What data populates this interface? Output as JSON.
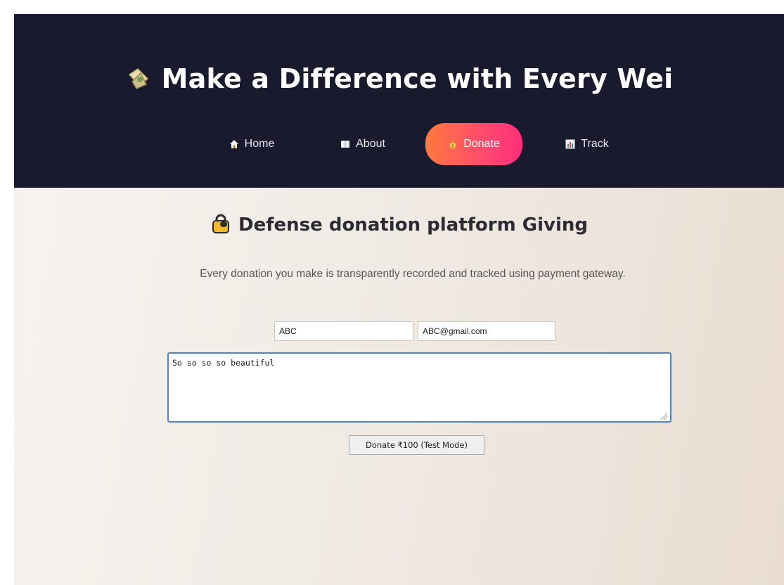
{
  "header": {
    "title": "Make a Difference with Every Wei",
    "title_icon": "money-wings-icon"
  },
  "nav": {
    "items": [
      {
        "label": "Home",
        "icon": "house-icon"
      },
      {
        "label": "About",
        "icon": "book-icon"
      },
      {
        "label": "Donate",
        "icon": "money-bag-icon",
        "active": true
      },
      {
        "label": "Track",
        "icon": "bar-chart-icon"
      }
    ]
  },
  "main": {
    "title": "Defense donation platform Giving",
    "title_icon": "lock-icon",
    "description": "Every donation you make is transparently recorded and tracked using payment gateway.",
    "form": {
      "name_value": "ABC",
      "email_value": "ABC@gmail.com",
      "message_value": "So so so so beautiful",
      "donate_button_label": "Donate ₹100 (Test Mode)"
    }
  },
  "colors": {
    "header_bg": "#191a2e",
    "accent_gradient_start": "#ff7a3d",
    "accent_gradient_end": "#ff2f7a",
    "focus_border": "#4d86c7"
  }
}
